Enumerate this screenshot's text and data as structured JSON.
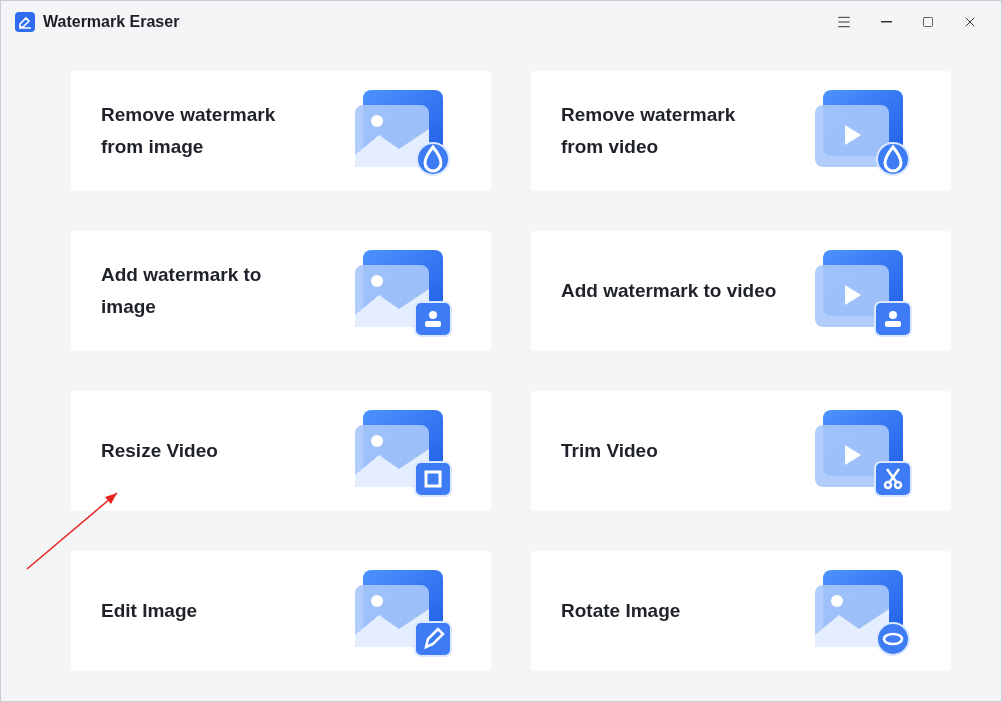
{
  "window": {
    "title": "Watermark Eraser"
  },
  "tools": [
    {
      "label": "Remove watermark\nfrom image"
    },
    {
      "label": "Remove watermark\nfrom video"
    },
    {
      "label": "Add watermark to\nimage"
    },
    {
      "label": "Add watermark to video"
    },
    {
      "label": "Resize Video"
    },
    {
      "label": "Trim Video"
    },
    {
      "label": "Edit Image"
    },
    {
      "label": "Rotate Image"
    }
  ]
}
